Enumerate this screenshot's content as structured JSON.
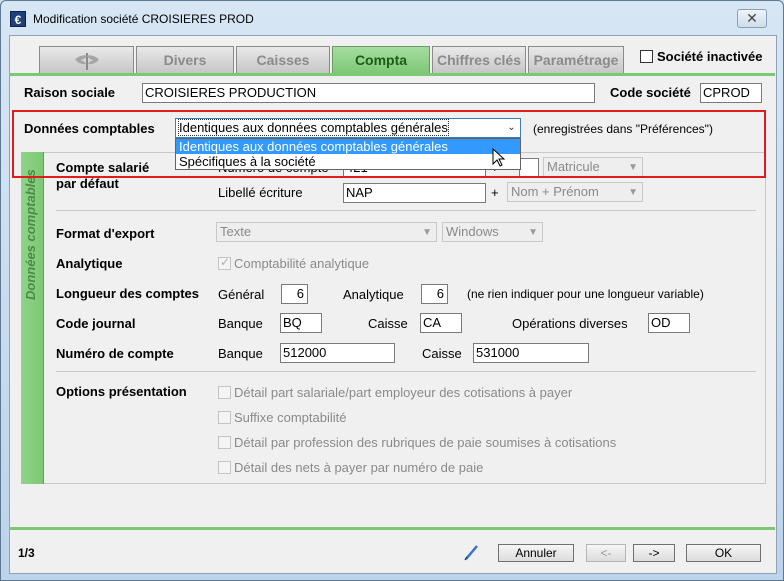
{
  "window": {
    "title": "Modification société CROISIERES PROD",
    "app_icon_glyph": "€",
    "close_glyph": "✕"
  },
  "tabs": [
    {
      "label": "",
      "icon": "dragonfly-icon"
    },
    {
      "label": "Divers"
    },
    {
      "label": "Caisses"
    },
    {
      "label": "Compta",
      "active": true
    },
    {
      "label": "Chiffres clés"
    },
    {
      "label": "Paramétrage"
    }
  ],
  "societe_inactive": {
    "label": "Société inactivée",
    "checked": false
  },
  "raison_sociale": {
    "label": "Raison sociale",
    "value": "CROISIERES PRODUCTION"
  },
  "code_societe": {
    "label": "Code société",
    "value": "CPROD"
  },
  "donnees_comptables": {
    "label": "Données comptables",
    "selected": "Identiques aux données comptables générales",
    "note": "(enregistrées dans \"Préférences\")",
    "options": [
      "Identiques aux données comptables générales",
      "Spécifiques à la société"
    ]
  },
  "side_tab": {
    "label": "Données comptables"
  },
  "compte_salarie": {
    "label_line1": "Compte salarié",
    "label_line2": "par défaut",
    "numero_label": "Numéro de compte",
    "numero_value": "421",
    "plus": "+",
    "matricule": "Matricule",
    "libelle_label": "Libellé écriture",
    "libelle_value": "NAP",
    "nom_prenom": "Nom + Prénom"
  },
  "format_export": {
    "label": "Format d'export",
    "value1": "Texte",
    "value2": "Windows"
  },
  "analytique": {
    "label": "Analytique",
    "option": "Comptabilité analytique",
    "checked": true
  },
  "longueur": {
    "label": "Longueur des comptes",
    "general_label": "Général",
    "general_value": "6",
    "analytique_label": "Analytique",
    "analytique_value": "6",
    "note": "(ne rien indiquer pour une longueur variable)"
  },
  "code_journal": {
    "label": "Code journal",
    "banque_label": "Banque",
    "banque_value": "BQ",
    "caisse_label": "Caisse",
    "caisse_value": "CA",
    "od_label": "Opérations diverses",
    "od_value": "OD"
  },
  "numero_compte": {
    "label": "Numéro de compte",
    "banque_label": "Banque",
    "banque_value": "512000",
    "caisse_label": "Caisse",
    "caisse_value": "531000"
  },
  "options_presentation": {
    "label": "Options présentation",
    "items": [
      "Détail part salariale/part employeur des cotisations à payer",
      "Suffixe comptabilité",
      "Détail par profession des rubriques de paie soumises à cotisations",
      "Détail des nets à payer par numéro de paie"
    ]
  },
  "footer": {
    "page": "1/3",
    "annuler": "Annuler",
    "prev": "<-",
    "next": "->",
    "ok": "OK"
  },
  "colors": {
    "accent_green": "#7cc874",
    "highlight_blue": "#3399ff",
    "annotation_red": "#e31b1b"
  }
}
